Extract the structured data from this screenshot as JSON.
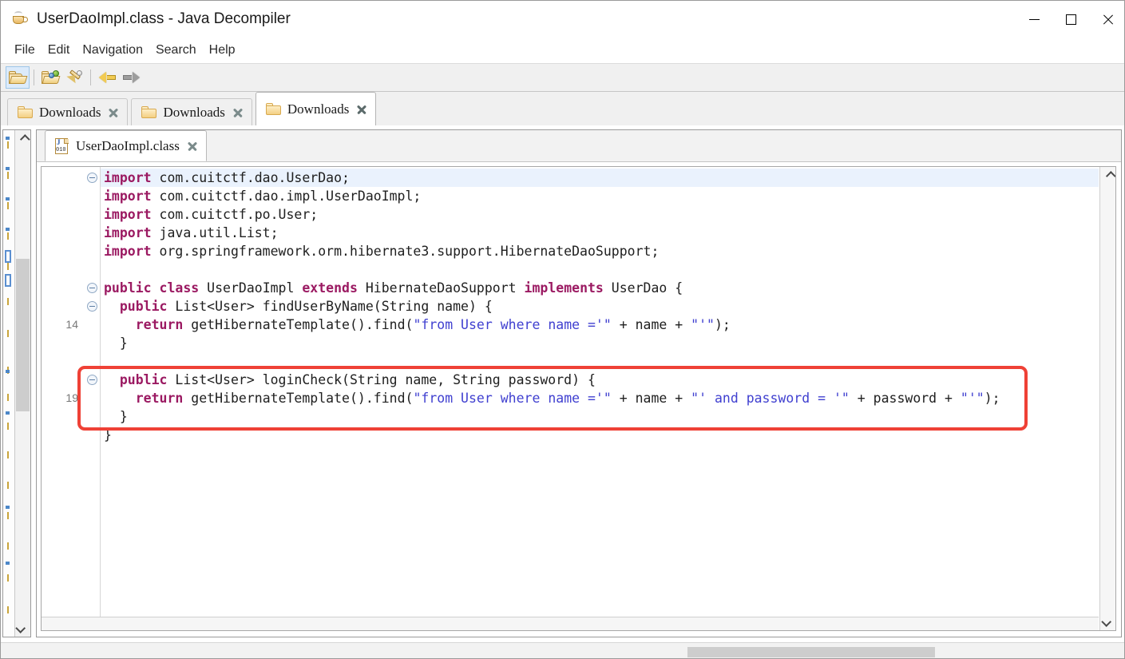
{
  "window": {
    "title": "UserDaoImpl.class - Java Decompiler",
    "app_icon": "java-coffee-cup-icon",
    "controls": {
      "minimize": "minimize-icon",
      "maximize": "maximize-icon",
      "close": "close-icon"
    }
  },
  "menubar": {
    "items": [
      {
        "label": "File"
      },
      {
        "label": "Edit"
      },
      {
        "label": "Navigation"
      },
      {
        "label": "Search"
      },
      {
        "label": "Help"
      }
    ]
  },
  "toolbar": {
    "buttons": [
      {
        "name": "open-file-button",
        "icon": "open-folder-icon",
        "active": true
      },
      {
        "name": "open-type-button",
        "icon": "open-folder-with-types-icon",
        "active": false
      },
      {
        "name": "open-recent-button",
        "icon": "pen-tool-icon",
        "active": false
      },
      {
        "name": "back-button",
        "icon": "arrow-left-icon",
        "active": false
      },
      {
        "name": "forward-button",
        "icon": "arrow-right-icon",
        "active": false
      }
    ]
  },
  "outer_tabs": [
    {
      "label": "Downloads",
      "icon": "folder-icon",
      "active": false
    },
    {
      "label": "Downloads",
      "icon": "folder-icon",
      "active": false
    },
    {
      "label": "Downloads",
      "icon": "folder-icon",
      "active": true
    }
  ],
  "inner_tabs": [
    {
      "label": "UserDaoImpl.class",
      "icon": "java-class-file-icon",
      "active": true
    }
  ],
  "editor": {
    "gutter_line_numbers": [
      "14",
      "19"
    ],
    "lines": [
      {
        "id": 0,
        "highlight": true,
        "fold": true,
        "tokens": [
          {
            "t": "kw",
            "v": "import"
          },
          {
            "t": "plain",
            "v": " com.cuitctf.dao.UserDao;"
          }
        ]
      },
      {
        "id": 1,
        "highlight": false,
        "fold": false,
        "tokens": [
          {
            "t": "kw",
            "v": "import"
          },
          {
            "t": "plain",
            "v": " com.cuitctf.dao.impl.UserDaoImpl;"
          }
        ]
      },
      {
        "id": 2,
        "highlight": false,
        "fold": false,
        "tokens": [
          {
            "t": "kw",
            "v": "import"
          },
          {
            "t": "plain",
            "v": " com.cuitctf.po.User;"
          }
        ]
      },
      {
        "id": 3,
        "highlight": false,
        "fold": false,
        "tokens": [
          {
            "t": "kw",
            "v": "import"
          },
          {
            "t": "plain",
            "v": " java.util.List;"
          }
        ]
      },
      {
        "id": 4,
        "highlight": false,
        "fold": false,
        "tokens": [
          {
            "t": "kw",
            "v": "import"
          },
          {
            "t": "plain",
            "v": " org.springframework.orm.hibernate3.support.HibernateDaoSupport;"
          }
        ]
      },
      {
        "id": 5,
        "highlight": false,
        "fold": false,
        "tokens": []
      },
      {
        "id": 6,
        "highlight": false,
        "fold": true,
        "tokens": [
          {
            "t": "kw",
            "v": "public class"
          },
          {
            "t": "plain",
            "v": " UserDaoImpl "
          },
          {
            "t": "kw",
            "v": "extends"
          },
          {
            "t": "plain",
            "v": " HibernateDaoSupport "
          },
          {
            "t": "kw",
            "v": "implements"
          },
          {
            "t": "plain",
            "v": " UserDao {"
          }
        ]
      },
      {
        "id": 7,
        "highlight": false,
        "fold": true,
        "tokens": [
          {
            "t": "plain",
            "v": "  "
          },
          {
            "t": "kw",
            "v": "public"
          },
          {
            "t": "plain",
            "v": " List<User> findUserByName(String name) {"
          }
        ]
      },
      {
        "id": 8,
        "highlight": false,
        "fold": false,
        "lineno": "14",
        "tokens": [
          {
            "t": "plain",
            "v": "    "
          },
          {
            "t": "kw",
            "v": "return"
          },
          {
            "t": "plain",
            "v": " getHibernateTemplate().find("
          },
          {
            "t": "str",
            "v": "\"from User where name ='\""
          },
          {
            "t": "plain",
            "v": " + name + "
          },
          {
            "t": "str",
            "v": "\"'\""
          },
          {
            "t": "plain",
            "v": ");"
          }
        ]
      },
      {
        "id": 9,
        "highlight": false,
        "fold": false,
        "tokens": [
          {
            "t": "plain",
            "v": "  }"
          }
        ]
      },
      {
        "id": 10,
        "highlight": false,
        "fold": false,
        "tokens": []
      },
      {
        "id": 11,
        "highlight": false,
        "fold": true,
        "tokens": [
          {
            "t": "plain",
            "v": "  "
          },
          {
            "t": "kw",
            "v": "public"
          },
          {
            "t": "plain",
            "v": " List<User> loginCheck(String name, String password) {"
          }
        ]
      },
      {
        "id": 12,
        "highlight": false,
        "fold": false,
        "lineno": "19",
        "tokens": [
          {
            "t": "plain",
            "v": "    "
          },
          {
            "t": "kw",
            "v": "return"
          },
          {
            "t": "plain",
            "v": " getHibernateTemplate().find("
          },
          {
            "t": "str",
            "v": "\"from User where name ='\""
          },
          {
            "t": "plain",
            "v": " + name + "
          },
          {
            "t": "str",
            "v": "\"' and password = '\""
          },
          {
            "t": "plain",
            "v": " + password + "
          },
          {
            "t": "str",
            "v": "\"'\""
          },
          {
            "t": "plain",
            "v": ");"
          }
        ]
      },
      {
        "id": 13,
        "highlight": false,
        "fold": false,
        "tokens": [
          {
            "t": "plain",
            "v": "  }"
          }
        ]
      },
      {
        "id": 14,
        "highlight": false,
        "fold": false,
        "tokens": [
          {
            "t": "plain",
            "v": "}"
          }
        ]
      }
    ]
  },
  "annotation": {
    "name": "red-highlight-box",
    "color": "#ef4136",
    "covers_lines": [
      11,
      12,
      13
    ]
  },
  "colors": {
    "keyword": "#9b1a62",
    "string": "#4040d0",
    "text": "#202020",
    "line_highlight": "#eaf2fd",
    "annotation_red": "#ef4136",
    "toolbar_bg": "#f0f0f0",
    "scrollbar_thumb": "#cdcdcd"
  },
  "scrollbars": {
    "left_vertical": {
      "name": "outline-scrollbar",
      "thumb_top_pct": 22,
      "thumb_height_pct": 30
    },
    "editor_vertical": {
      "name": "editor-vertical-scrollbar"
    },
    "bottom_horizontal": {
      "name": "window-horizontal-scrollbar"
    }
  }
}
